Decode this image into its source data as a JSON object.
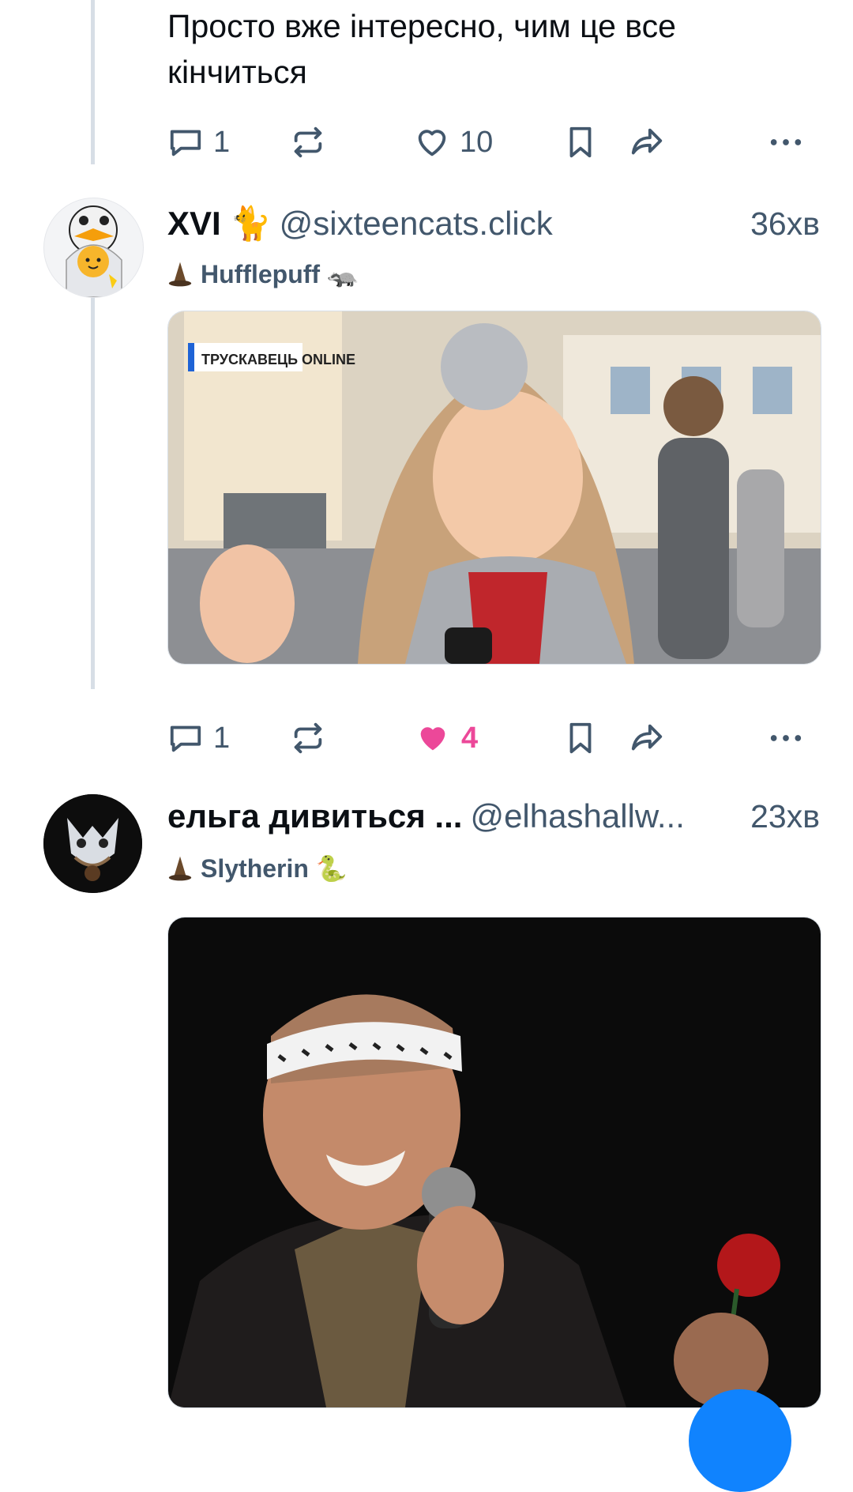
{
  "post1": {
    "text_line1": "Просто вже інтересно, чим це все",
    "text_line2": "кінчиться",
    "replies": "1",
    "likes": "10"
  },
  "post2": {
    "display_name": "XVI 🐈",
    "handle": "@sixteencats.click",
    "time": "36хв",
    "house": "Hufflepuff 🦡",
    "house_icon": "sorting-hat-icon",
    "media_caption": "ТРУСКАВЕЦЬ ONLINE",
    "replies": "1",
    "likes": "4",
    "liked": true,
    "like_color": "#ec4899"
  },
  "post3": {
    "display_name": "ельга дивиться ...",
    "handle": "@elhashallw...",
    "time": "23хв",
    "house": "Slytherin 🐍"
  },
  "colors": {
    "text": "#0b0f14",
    "muted": "#42576c",
    "thread_line": "#d7dee6",
    "fab": "#1083fe"
  }
}
